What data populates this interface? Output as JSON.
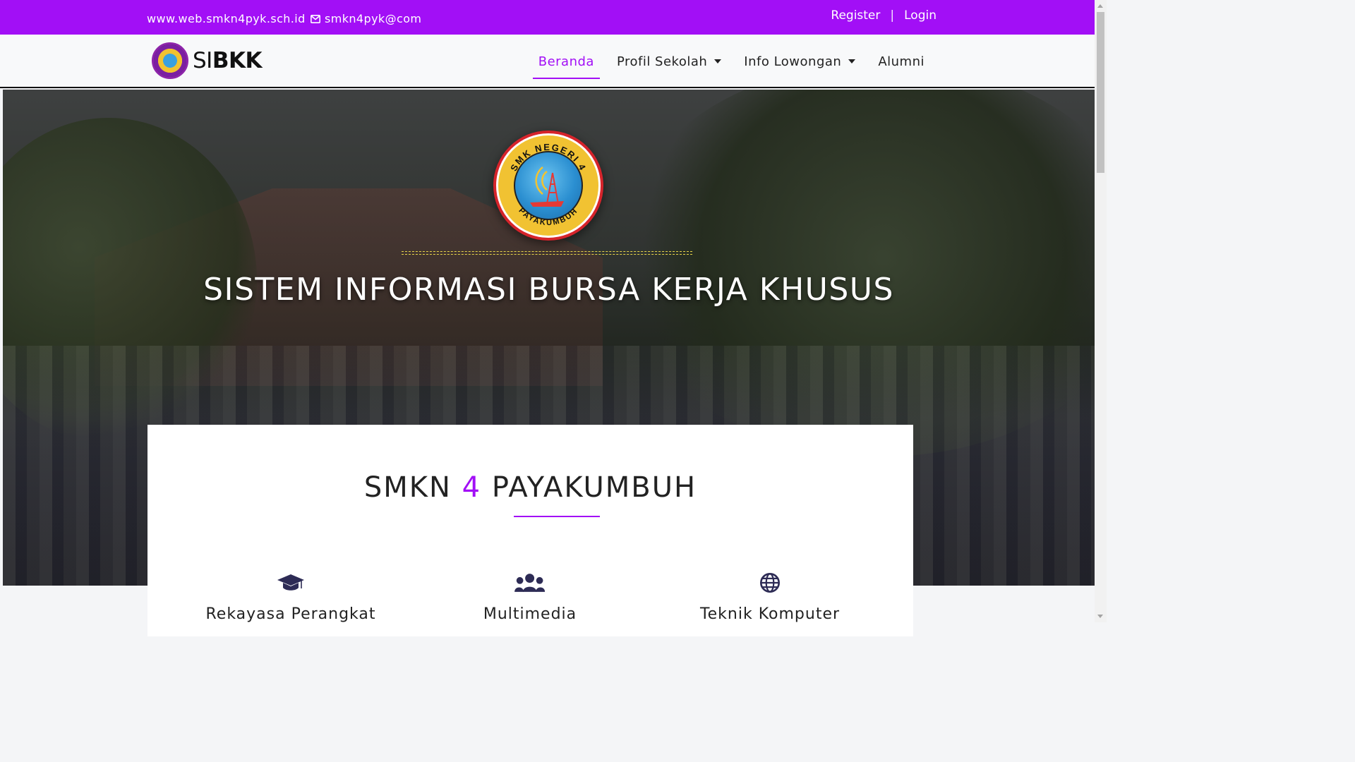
{
  "colors": {
    "accent": "#a20ff6",
    "topbar_bg": "#a20ff6",
    "navbar_bg": "#f8f9fa",
    "hero_line": "#e8d54a"
  },
  "topbar": {
    "website": "www.web.smkn4pyk.sch.id",
    "email": "smkn4pyk@com",
    "email_icon": "envelope-icon",
    "register": "Register",
    "separator": "|",
    "login": "Login"
  },
  "brand": {
    "prefix": "SI",
    "name": "BKK"
  },
  "nav": {
    "items": [
      {
        "label": "Beranda",
        "active": true
      },
      {
        "label": "Profil Sekolah",
        "dropdown": true
      },
      {
        "label": "Info Lowongan",
        "dropdown": true
      },
      {
        "label": "Alumni"
      }
    ]
  },
  "hero": {
    "title": "SISTEM INFORMASI BURSA KERJA KHUSUS",
    "logo_text_top": "SMK NEGERI 4",
    "logo_text_bottom": "PAYAKUMBUH"
  },
  "section": {
    "title_before": "SMKN",
    "title_number": "4",
    "title_after": "PAYAKUMBUH"
  },
  "features": [
    {
      "label": "Rekayasa Perangkat",
      "icon": "graduation-cap-icon"
    },
    {
      "label": "Multimedia",
      "icon": "users-icon"
    },
    {
      "label": "Teknik Komputer",
      "icon": "globe-icon"
    }
  ]
}
